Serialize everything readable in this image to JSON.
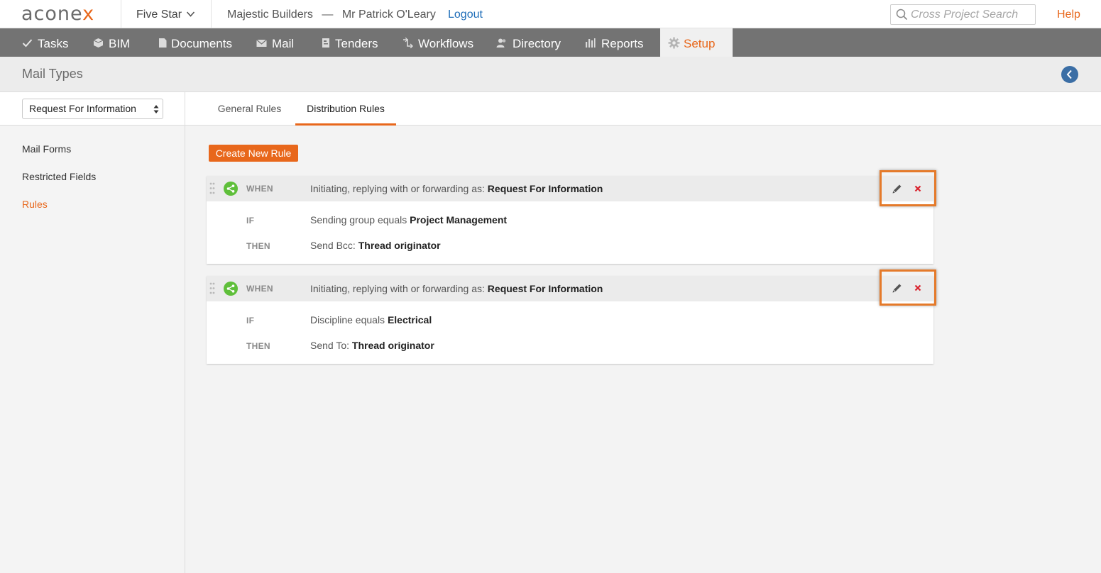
{
  "header": {
    "logo_main": "acone",
    "logo_x": "x",
    "project": "Five Star",
    "org": "Majestic Builders",
    "separator": "—",
    "user": "Mr Patrick O'Leary",
    "logout": "Logout",
    "search_placeholder": "Cross Project Search",
    "help": "Help"
  },
  "nav": {
    "items": [
      {
        "label": "Tasks",
        "icon": "check-icon"
      },
      {
        "label": "BIM",
        "icon": "cube-icon"
      },
      {
        "label": "Documents",
        "icon": "document-icon"
      },
      {
        "label": "Mail",
        "icon": "envelope-icon"
      },
      {
        "label": "Tenders",
        "icon": "tender-icon"
      },
      {
        "label": "Workflows",
        "icon": "workflow-icon"
      },
      {
        "label": "Directory",
        "icon": "people-icon"
      },
      {
        "label": "Reports",
        "icon": "bar-chart-icon"
      },
      {
        "label": "Setup",
        "icon": "gear-icon",
        "active": true
      }
    ]
  },
  "page": {
    "title": "Mail Types"
  },
  "sidebar": {
    "select_value": "Request For Information",
    "links": [
      {
        "label": "Mail Forms"
      },
      {
        "label": "Restricted Fields"
      },
      {
        "label": "Rules",
        "active": true
      }
    ]
  },
  "tabs": [
    {
      "label": "General Rules"
    },
    {
      "label": "Distribution Rules",
      "active": true
    }
  ],
  "main": {
    "create_button": "Create New Rule",
    "rules": [
      {
        "when_label": "WHEN",
        "when_text": "Initiating, replying with or forwarding as:",
        "when_value": "Request For Information",
        "if_label": "IF",
        "if_text": "Sending group equals",
        "if_value": "Project Management",
        "then_label": "THEN",
        "then_text": "Send Bcc:",
        "then_value": "Thread originator"
      },
      {
        "when_label": "WHEN",
        "when_text": "Initiating, replying with or forwarding as:",
        "when_value": "Request For Information",
        "if_label": "IF",
        "if_text": "Discipline equals",
        "if_value": "Electrical",
        "then_label": "THEN",
        "then_text": "Send To:",
        "then_value": "Thread originator"
      }
    ]
  },
  "colors": {
    "accent": "#e8671b",
    "nav_bg": "#737373",
    "link": "#1e6db8",
    "rule_icon": "#5fbf3a",
    "delete": "#d9232e"
  }
}
